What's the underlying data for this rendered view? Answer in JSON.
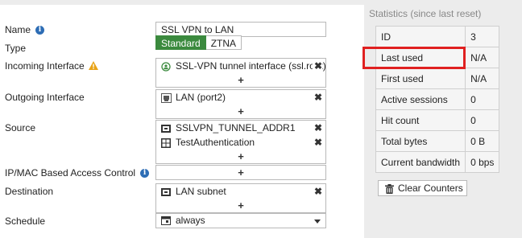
{
  "form": {
    "name": {
      "label": "Name",
      "value": "SSL VPN to LAN"
    },
    "type": {
      "label": "Type",
      "options": [
        "Standard",
        "ZTNA"
      ],
      "selected": "Standard"
    },
    "incoming": {
      "label": "Incoming Interface",
      "entries": [
        "SSL-VPN tunnel interface (ssl.root)"
      ]
    },
    "outgoing": {
      "label": "Outgoing Interface",
      "entries": [
        "LAN (port2)"
      ]
    },
    "source": {
      "label": "Source",
      "entries": [
        "SSLVPN_TUNNEL_ADDR1",
        "TestAuthentication"
      ]
    },
    "ipmac": {
      "label": "IP/MAC Based Access Control"
    },
    "destination": {
      "label": "Destination",
      "entries": [
        "LAN subnet"
      ]
    },
    "schedule": {
      "label": "Schedule",
      "value": "always"
    },
    "add_symbol": "+",
    "remove_symbol": "✖"
  },
  "statistics": {
    "title": "Statistics (since last reset)",
    "rows": [
      {
        "key": "ID",
        "value": "3"
      },
      {
        "key": "Last used",
        "value": "N/A"
      },
      {
        "key": "First used",
        "value": "N/A"
      },
      {
        "key": "Active sessions",
        "value": "0"
      },
      {
        "key": "Hit count",
        "value": "0"
      },
      {
        "key": "Total bytes",
        "value": "0 B"
      },
      {
        "key": "Current bandwidth",
        "value": "0 bps"
      }
    ],
    "highlighted_row": "Last used",
    "clear_button": "Clear Counters"
  },
  "colors": {
    "accent_green": "#3b8a3e",
    "info_blue": "#2d6db5",
    "warning_yellow": "#e8a317",
    "highlight_red": "#e02020"
  },
  "icons": {
    "name_info": "info-icon",
    "incoming_warning": "warning-icon",
    "incoming_entry": "ssl-vpn-interface-icon",
    "outgoing_entry": "network-port-icon",
    "source_entry_1": "address-object-icon",
    "source_entry_2": "user-group-icon",
    "destination_entry": "address-object-icon",
    "schedule_entry": "calendar-icon",
    "clear_button": "trash-icon"
  }
}
